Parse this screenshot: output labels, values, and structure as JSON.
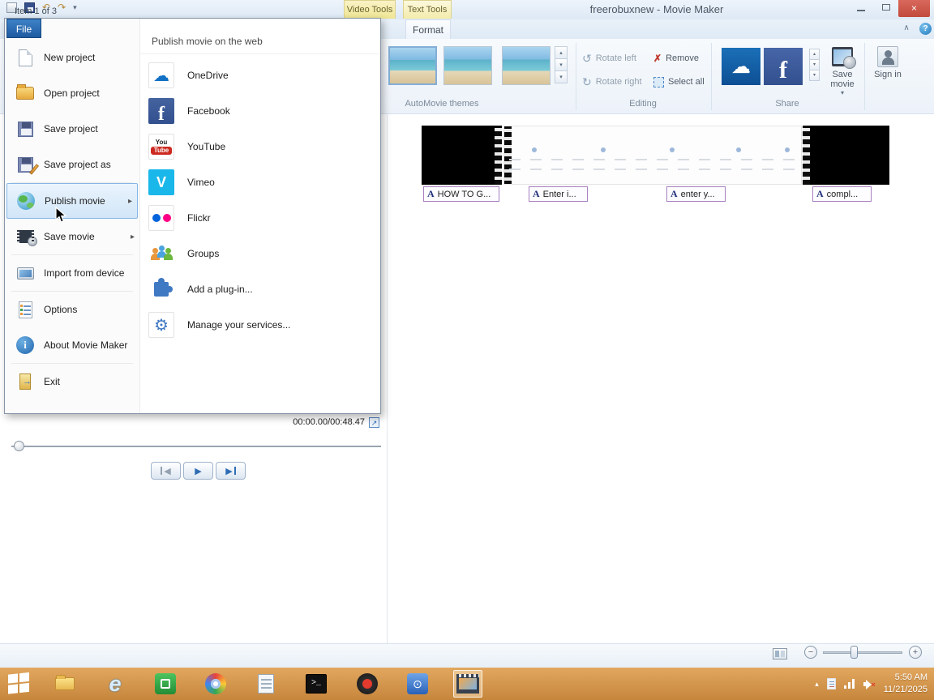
{
  "colors": {
    "accent_blue": "#2a6cb5",
    "close_red": "#c14a3c",
    "taskbar_orange": "#d0914c",
    "highlight_blue": "#d2e6f8",
    "caption_purple": "#a87fc0",
    "facebook_blue": "#3b5998",
    "onedrive_blue": "#0d4f94"
  },
  "titlebar": {
    "title": "freerobuxnew - Movie Maker",
    "video_tools_tab": "Video Tools",
    "text_tools_tab": "Text Tools"
  },
  "ribbon": {
    "format_tab": "Format",
    "automovie_label": "AutoMovie themes",
    "editing": {
      "label": "Editing",
      "rotate_left": "Rotate left",
      "rotate_right": "Rotate right",
      "remove": "Remove",
      "select_all": "Select all"
    },
    "share": {
      "label": "Share",
      "save_movie": "Save movie",
      "sign_in": "Sign in"
    }
  },
  "file_menu": {
    "file_button": "File",
    "items": [
      {
        "label": "New project"
      },
      {
        "label": "Open project"
      },
      {
        "label": "Save project"
      },
      {
        "label": "Save project as"
      },
      {
        "label": "Publish movie"
      },
      {
        "label": "Save movie"
      },
      {
        "label": "Import from device"
      },
      {
        "label": "Options"
      },
      {
        "label": "About Movie Maker"
      },
      {
        "label": "Exit"
      }
    ],
    "submenu": {
      "header": "Publish movie on the web",
      "items": [
        {
          "label": "OneDrive"
        },
        {
          "label": "Facebook"
        },
        {
          "label": "YouTube"
        },
        {
          "label": "Vimeo"
        },
        {
          "label": "Flickr"
        },
        {
          "label": "Groups"
        },
        {
          "label": "Add a plug-in..."
        },
        {
          "label": "Manage your services..."
        }
      ]
    }
  },
  "storyboard": {
    "title_prefix": "A",
    "captions": [
      "HOW TO G...",
      "Enter i...",
      "enter y...",
      "compl..."
    ]
  },
  "preview": {
    "time": "00:00.00/00:48.47"
  },
  "status_bar": {
    "item_text": "Item 1 of 3"
  },
  "taskbar": {
    "time": "5:50 AM",
    "date": "11/21/2025"
  },
  "icons": {
    "close": "×",
    "help": "?",
    "collapse": "∧",
    "dropdown": "▾",
    "scroll_up": "▴",
    "scroll_down": "▾",
    "submenu_arrow": "▸",
    "play": "▶",
    "prev": "◀",
    "next": "▶",
    "undo": "↶",
    "redo": "↷",
    "rotate_left": "↺",
    "rotate_right": "↻",
    "remove_x": "✗",
    "cloud": "☁",
    "facebook_f": "f",
    "vimeo_v": "V",
    "youtube_you": "You",
    "youtube_tube": "Tube",
    "gear": "⚙",
    "info": "i",
    "expand": "↗",
    "zoom_in": "+",
    "zoom_out": "−",
    "tray_up": "▴",
    "terminal": ">_",
    "blue_app_glyph": "⊙",
    "mute_x": "×"
  }
}
